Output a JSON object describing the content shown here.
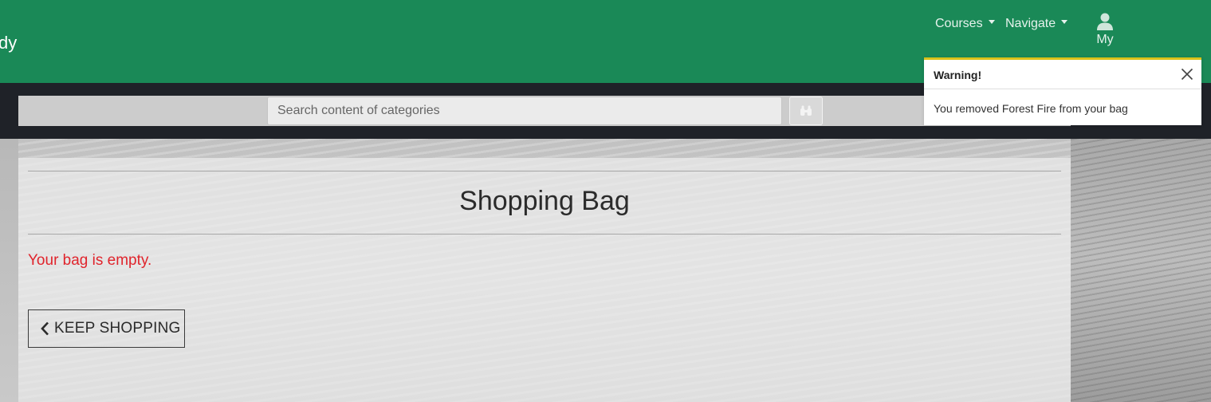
{
  "header": {
    "brand_fragment": "dy",
    "nav": [
      {
        "label": "Courses"
      },
      {
        "label": "Navigate"
      }
    ],
    "account_label": "My",
    "account_icon": "user-icon"
  },
  "search": {
    "placeholder": "Search content of categories",
    "button_icon": "binoculars-icon"
  },
  "main": {
    "title": "Shopping Bag",
    "empty_message": "Your bag is empty.",
    "keep_shopping_label": "KEEP SHOPPING",
    "keep_shopping_icon": "chevron-left-icon"
  },
  "toast": {
    "title": "Warning!",
    "message": "You removed Forest Fire from your bag",
    "close_icon": "close-icon",
    "accent_color": "#d9c21a"
  },
  "colors": {
    "brand_green": "#1a8957",
    "dark_bar": "#1f2228",
    "error_red": "#e0242c"
  }
}
